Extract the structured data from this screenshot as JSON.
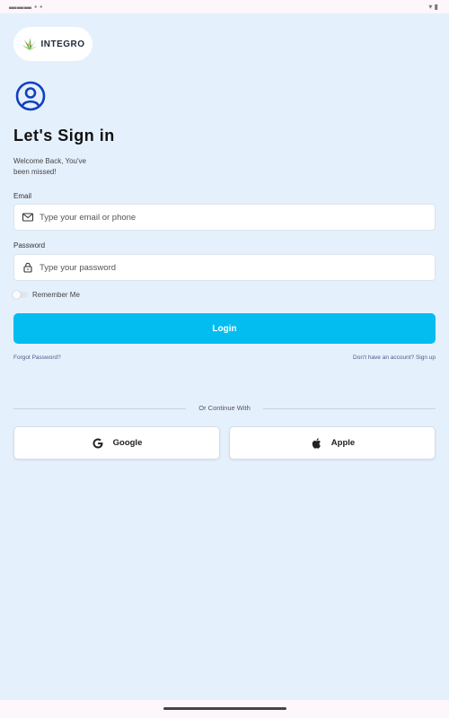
{
  "app": {
    "logo_text": "INTEGRO"
  },
  "header": {
    "title": "Let's Sign in",
    "subtitle": "Welcome Back, You've been missed!"
  },
  "form": {
    "email_label": "Email",
    "email_placeholder": "Type your email or phone",
    "email_value": "",
    "password_label": "Password",
    "password_placeholder": "Type your password",
    "password_value": "",
    "remember_label": "Remember Me",
    "remember_checked": false,
    "login_label": "Login"
  },
  "links": {
    "forgot_password": "Forgot Password?",
    "no_account_prefix": "Don't have an account? ",
    "sign_up": "Sign up"
  },
  "social": {
    "divider_text": "Or Continue With",
    "google_label": "Google",
    "apple_label": "Apple"
  },
  "icons": {
    "user": "user-circle-icon",
    "email": "mail-icon",
    "password": "lock-icon",
    "google": "google-icon",
    "apple": "apple-icon"
  },
  "colors": {
    "accent": "#03bdf0",
    "background": "#e5f0fd",
    "user_icon": "#1040c0"
  }
}
